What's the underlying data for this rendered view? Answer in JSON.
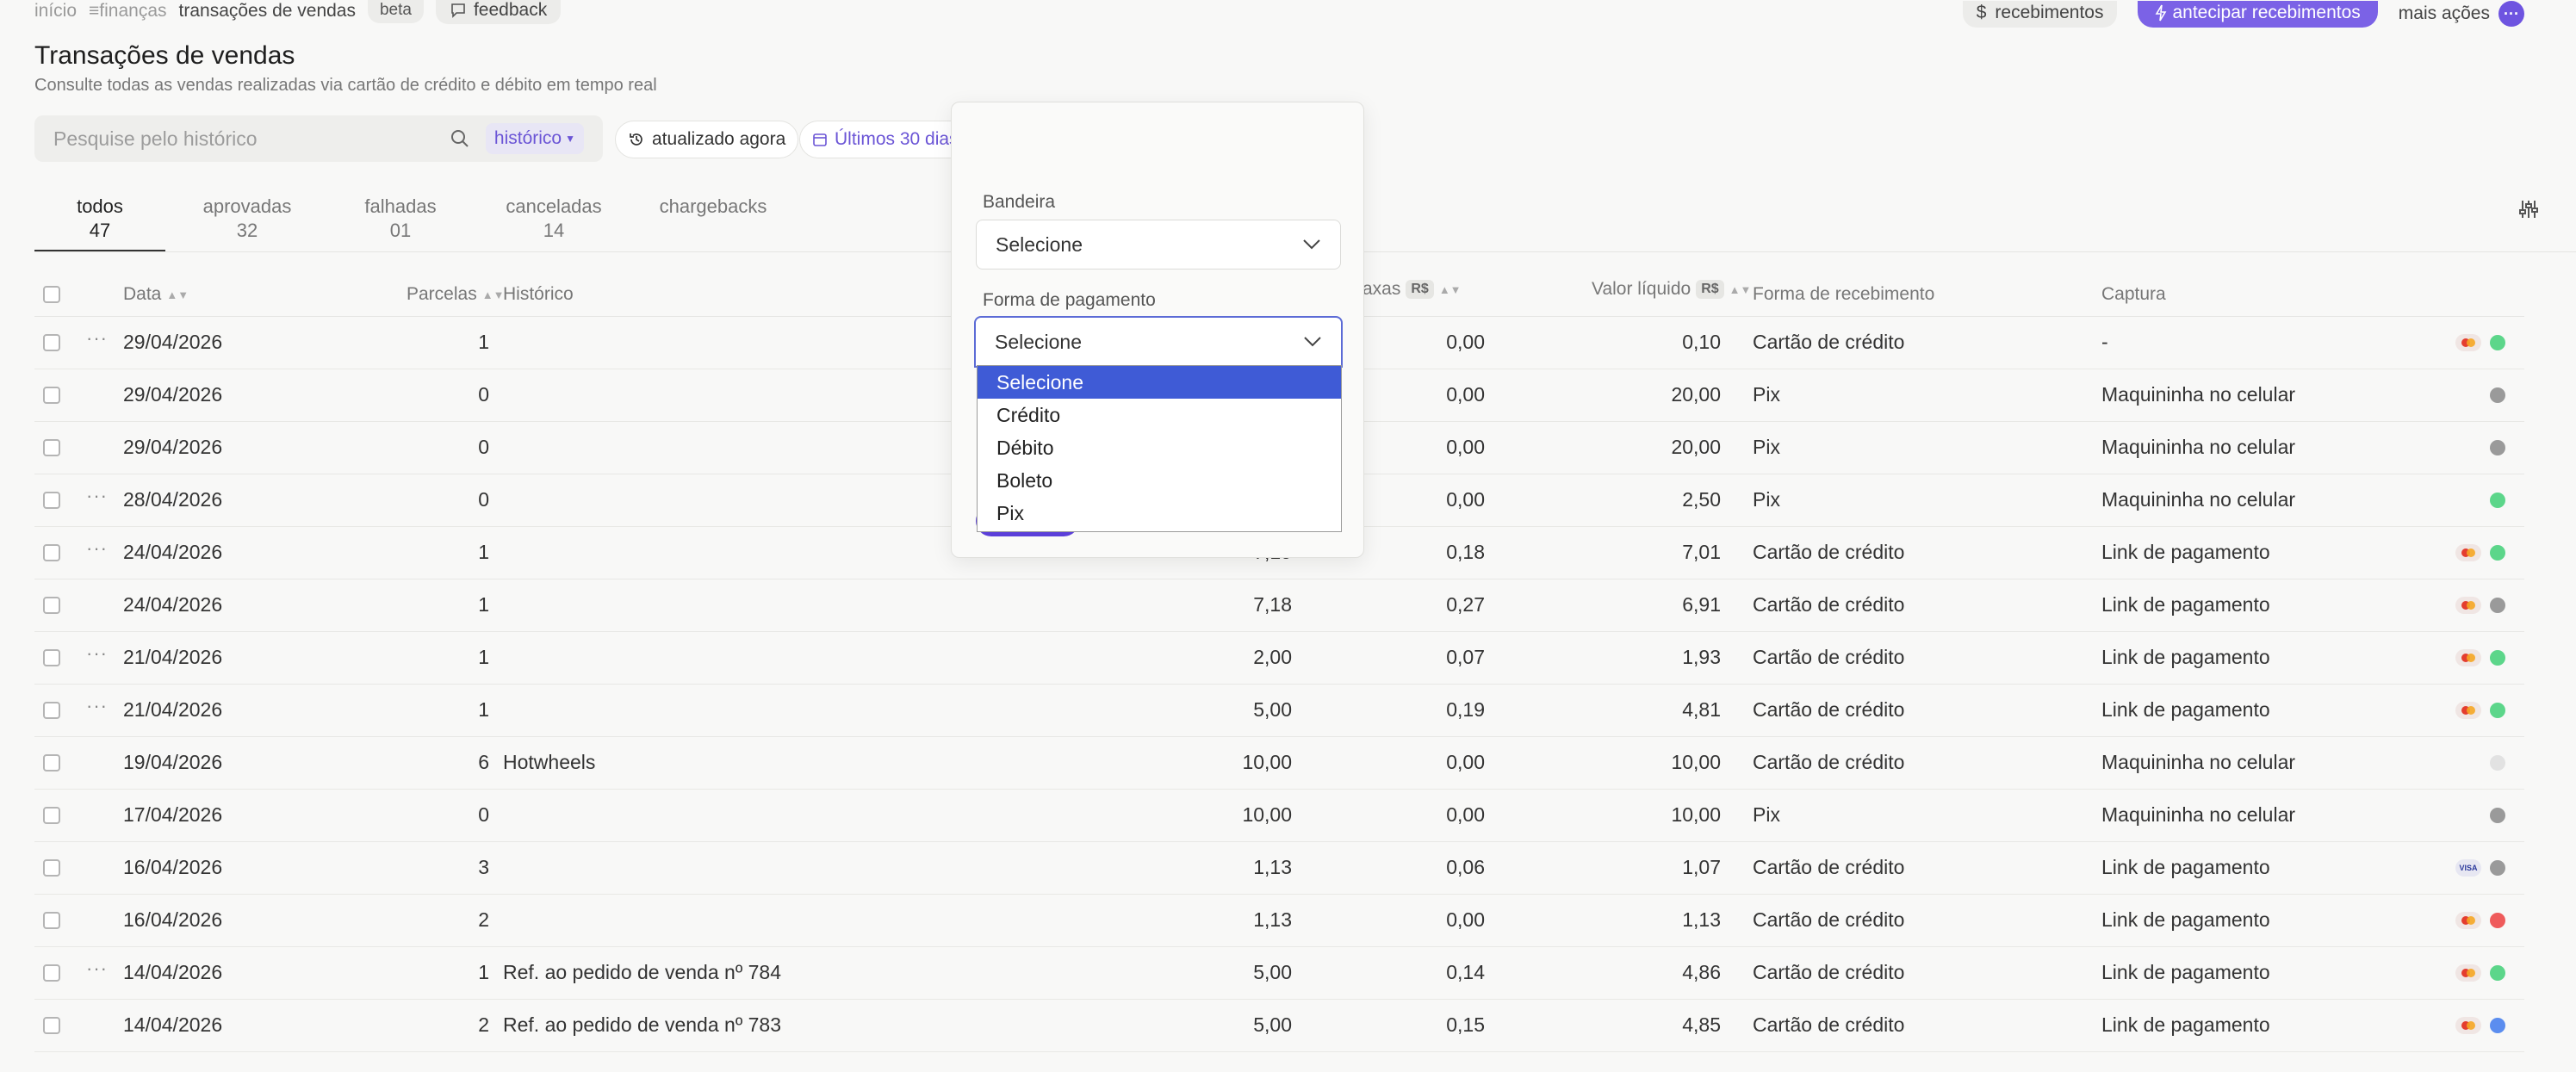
{
  "breadcrumb": {
    "home": "início",
    "section": "finanças",
    "current": "transações de vendas",
    "beta": "beta",
    "feedback": "feedback"
  },
  "topActions": {
    "receivables": "recebimentos",
    "anticipate": "antecipar recebimentos",
    "more": "mais ações"
  },
  "page": {
    "title": "Transações de vendas",
    "subtitle": "Consulte todas as vendas realizadas via cartão de crédito e débito em tempo real"
  },
  "search": {
    "placeholder": "Pesquise pelo histórico",
    "scope": "histórico"
  },
  "chips": {
    "updated": "atualizado agora",
    "period": "Últimos 30 dias",
    "filters": "filtros"
  },
  "tabs": [
    {
      "label": "todos",
      "count": "47"
    },
    {
      "label": "aprovadas",
      "count": "32"
    },
    {
      "label": "falhadas",
      "count": "01"
    },
    {
      "label": "canceladas",
      "count": "14"
    },
    {
      "label": "chargebacks",
      "count": ""
    }
  ],
  "columns": {
    "date": "Data",
    "installments": "Parcelas",
    "history": "Histórico",
    "fees": "axas",
    "net": "Valor líquido",
    "currency": "R$",
    "receiveMethod": "Forma de recebimento",
    "capture": "Captura"
  },
  "rows": [
    {
      "date": "29/04/2026",
      "inst": "1",
      "hist": "",
      "gross": "",
      "fees": "0,00",
      "net": "0,10",
      "method": "Cartão de crédito",
      "capture": "-",
      "brand": "mastercard",
      "status": "#5cd68a",
      "menu": true
    },
    {
      "date": "29/04/2026",
      "inst": "0",
      "hist": "",
      "gross": "",
      "fees": "0,00",
      "net": "20,00",
      "method": "Pix",
      "capture": "Maquininha no celular",
      "brand": "",
      "status": "#9a9a9a",
      "menu": false
    },
    {
      "date": "29/04/2026",
      "inst": "0",
      "hist": "",
      "gross": "",
      "fees": "0,00",
      "net": "20,00",
      "method": "Pix",
      "capture": "Maquininha no celular",
      "brand": "",
      "status": "#9a9a9a",
      "menu": false
    },
    {
      "date": "28/04/2026",
      "inst": "0",
      "hist": "",
      "gross": "",
      "fees": "0,00",
      "net": "2,50",
      "method": "Pix",
      "capture": "Maquininha no celular",
      "brand": "",
      "status": "#5cd68a",
      "menu": true
    },
    {
      "date": "24/04/2026",
      "inst": "1",
      "hist": "",
      "gross": "7,19",
      "fees": "0,18",
      "net": "7,01",
      "method": "Cartão de crédito",
      "capture": "Link de pagamento",
      "brand": "mastercard",
      "status": "#5cd68a",
      "menu": true
    },
    {
      "date": "24/04/2026",
      "inst": "1",
      "hist": "",
      "gross": "7,18",
      "fees": "0,27",
      "net": "6,91",
      "method": "Cartão de crédito",
      "capture": "Link de pagamento",
      "brand": "mastercard",
      "status": "#9a9a9a",
      "menu": false
    },
    {
      "date": "21/04/2026",
      "inst": "1",
      "hist": "",
      "gross": "2,00",
      "fees": "0,07",
      "net": "1,93",
      "method": "Cartão de crédito",
      "capture": "Link de pagamento",
      "brand": "mastercard",
      "status": "#5cd68a",
      "menu": true
    },
    {
      "date": "21/04/2026",
      "inst": "1",
      "hist": "",
      "gross": "5,00",
      "fees": "0,19",
      "net": "4,81",
      "method": "Cartão de crédito",
      "capture": "Link de pagamento",
      "brand": "mastercard",
      "status": "#5cd68a",
      "menu": true
    },
    {
      "date": "19/04/2026",
      "inst": "6",
      "hist": "Hotwheels",
      "gross": "10,00",
      "fees": "0,00",
      "net": "10,00",
      "method": "Cartão de crédito",
      "capture": "Maquininha no celular",
      "brand": "",
      "status": "#e2e2e2",
      "menu": false
    },
    {
      "date": "17/04/2026",
      "inst": "0",
      "hist": "",
      "gross": "10,00",
      "fees": "0,00",
      "net": "10,00",
      "method": "Pix",
      "capture": "Maquininha no celular",
      "brand": "",
      "status": "#9a9a9a",
      "menu": false
    },
    {
      "date": "16/04/2026",
      "inst": "3",
      "hist": "",
      "gross": "1,13",
      "fees": "0,06",
      "net": "1,07",
      "method": "Cartão de crédito",
      "capture": "Link de pagamento",
      "brand": "visa",
      "status": "#9a9a9a",
      "menu": false
    },
    {
      "date": "16/04/2026",
      "inst": "2",
      "hist": "",
      "gross": "1,13",
      "fees": "0,00",
      "net": "1,13",
      "method": "Cartão de crédito",
      "capture": "Link de pagamento",
      "brand": "mastercard",
      "status": "#ef5b5b",
      "menu": false
    },
    {
      "date": "14/04/2026",
      "inst": "1",
      "hist": "Ref. ao pedido de venda nº 784",
      "gross": "5,00",
      "fees": "0,14",
      "net": "4,86",
      "method": "Cartão de crédito",
      "capture": "Link de pagamento",
      "brand": "mastercard",
      "status": "#5cd68a",
      "menu": true
    },
    {
      "date": "14/04/2026",
      "inst": "2",
      "hist": "Ref. ao pedido de venda nº 783",
      "gross": "5,00",
      "fees": "0,15",
      "net": "4,85",
      "method": "Cartão de crédito",
      "capture": "Link de pagamento",
      "brand": "mastercard",
      "status": "#5b8def",
      "menu": false
    }
  ],
  "filters": {
    "brandLabel": "Bandeira",
    "brandValue": "Selecione",
    "paymentLabel": "Forma de pagamento",
    "paymentValue": "Selecione",
    "paymentOptions": [
      "Selecione",
      "Crédito",
      "Débito",
      "Boleto",
      "Pix"
    ],
    "selectedIndex": 0
  },
  "colors": {
    "accent": "#7b62e6",
    "dropdownSelected": "#3f5bd6"
  }
}
